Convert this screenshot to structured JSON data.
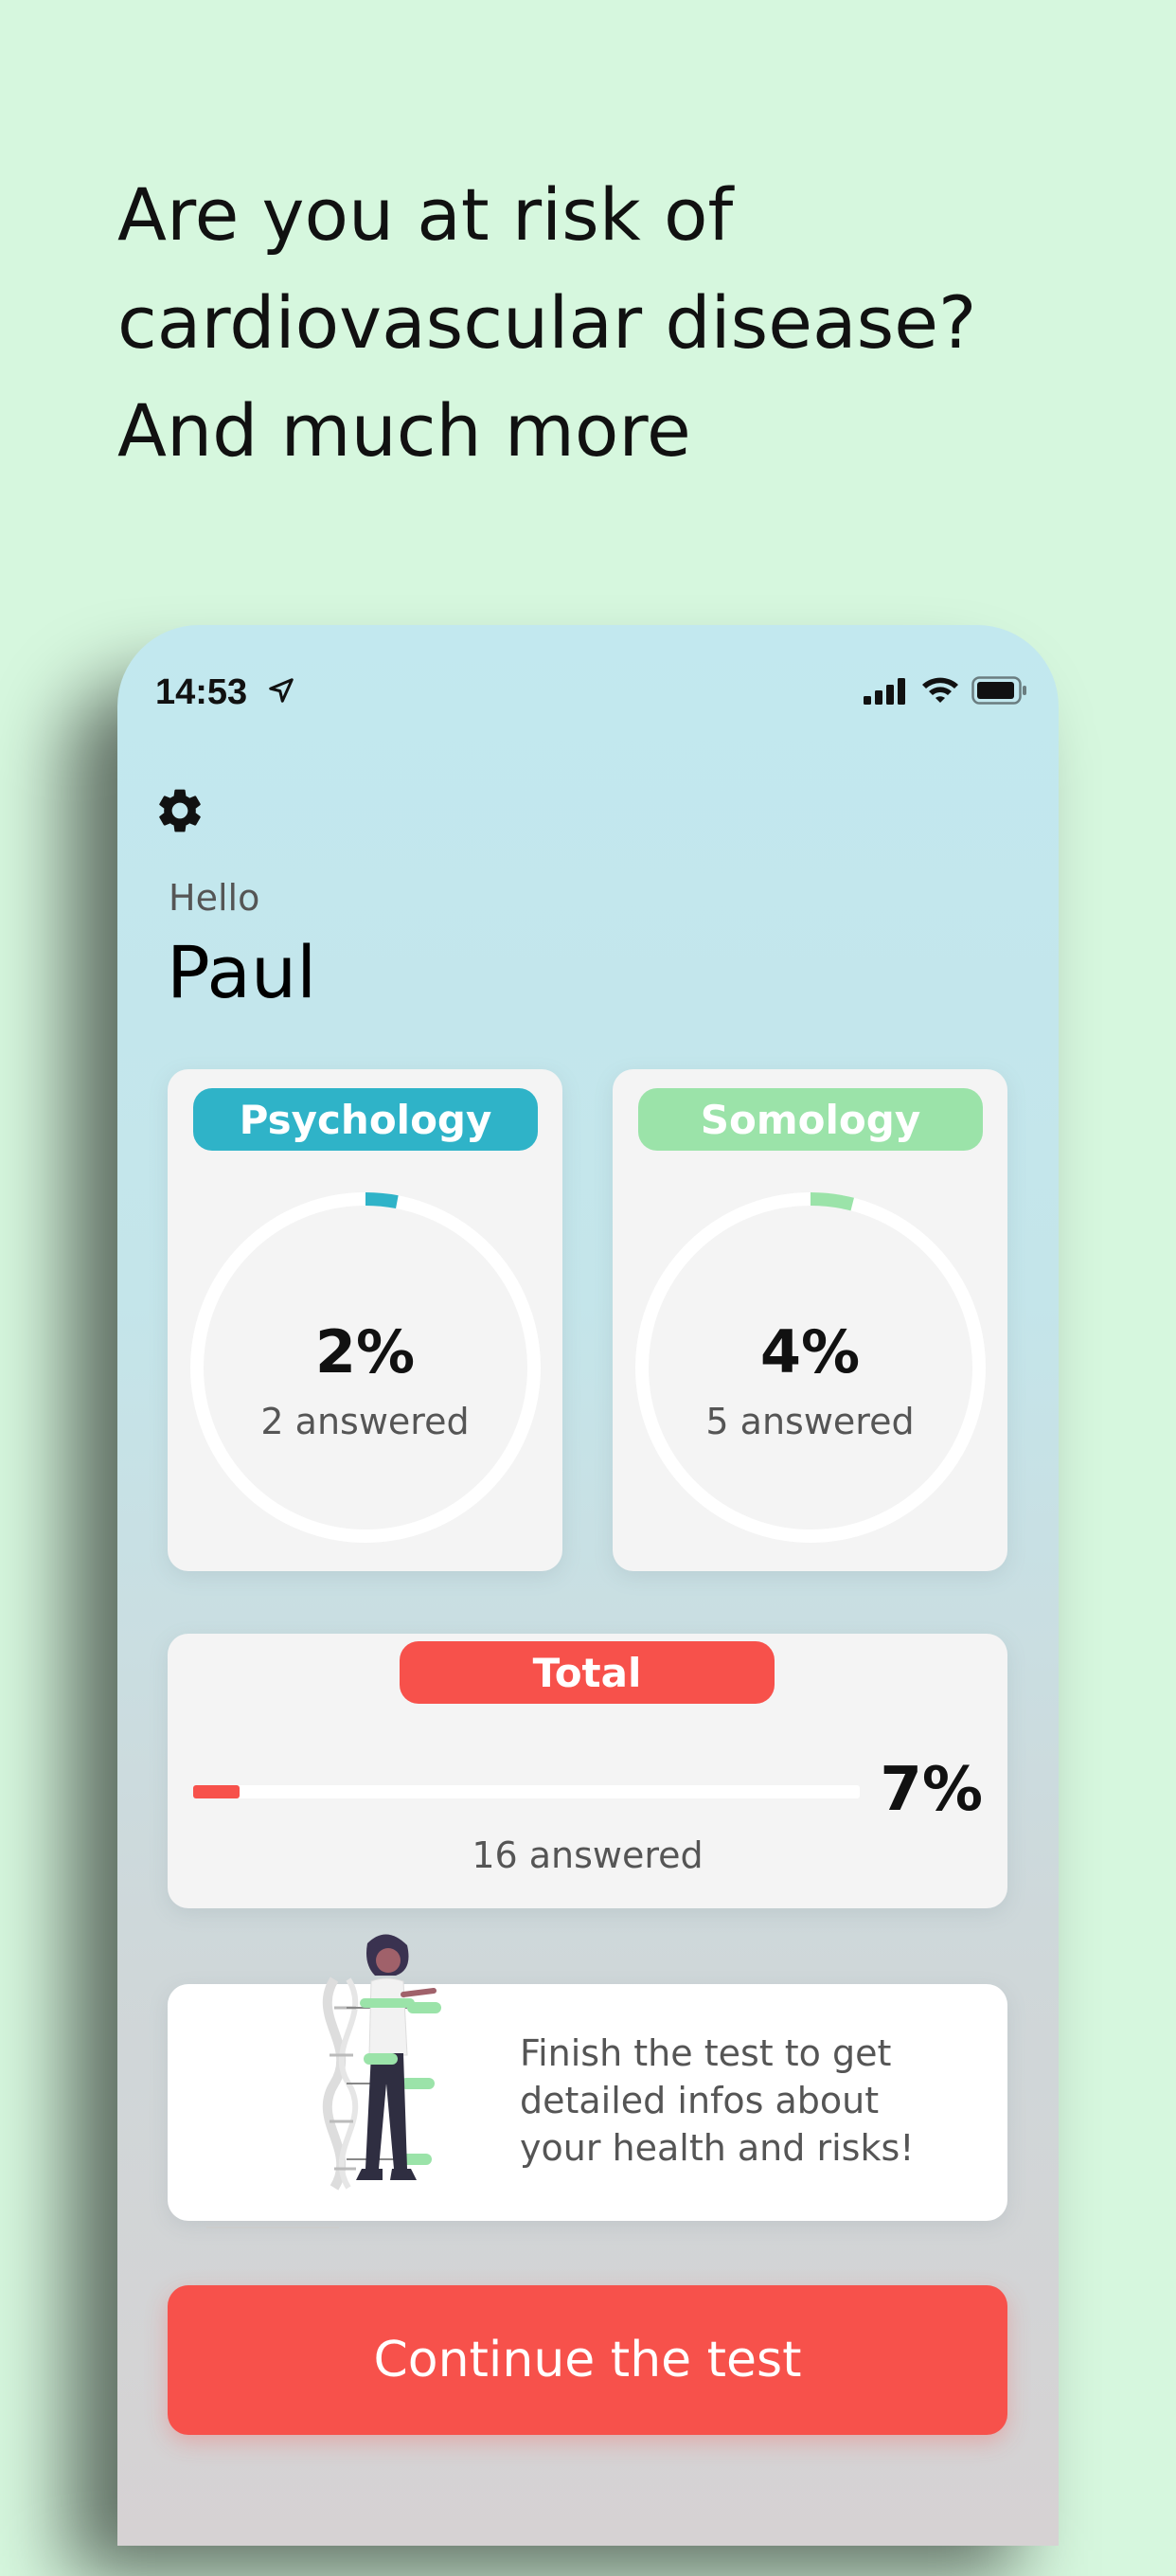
{
  "headline": {
    "line1": "Are you at risk of",
    "line2": "cardiovascular disease?",
    "line3": "And much more"
  },
  "status_bar": {
    "time": "14:53",
    "icons": [
      "location-arrow-icon",
      "cellular-signal-icon",
      "wifi-icon",
      "battery-icon"
    ]
  },
  "settings": {
    "icon": "gear-icon"
  },
  "greeting": {
    "hello": "Hello",
    "name": "Paul"
  },
  "categories": [
    {
      "label": "Psychology",
      "percent": "2%",
      "percent_value": 0.02,
      "answered": "2 answered",
      "color": "#2fb3c8"
    },
    {
      "label": "Somology",
      "percent": "4%",
      "percent_value": 0.04,
      "answered": "5 answered",
      "color": "#9be3a9"
    }
  ],
  "total": {
    "label": "Total",
    "percent": "7%",
    "percent_value": 0.07,
    "answered": "16 answered",
    "color": "#f7514b"
  },
  "info_card": {
    "text_line1": "Finish the test to get",
    "text_line2": "detailed infos about",
    "text_line3": "your health and risks!",
    "illustration": "person-with-dna-chart-illustration"
  },
  "cta": {
    "label": "Continue the test"
  },
  "colors": {
    "background": "#d6f7de",
    "accent_red": "#f7514b",
    "psych_blue": "#2fb3c8",
    "soma_green": "#9be3a9"
  }
}
